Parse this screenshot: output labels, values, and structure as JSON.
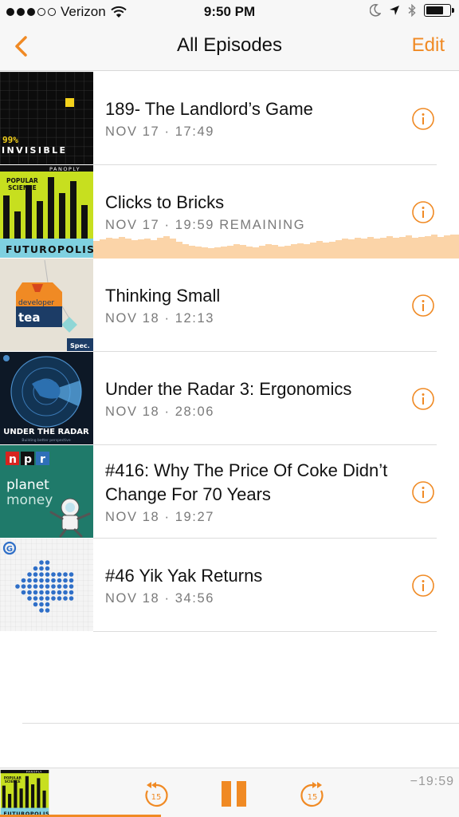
{
  "status_bar": {
    "carrier": "Verizon",
    "time": "9:50 PM",
    "signal_bars_filled": 3,
    "signal_bars_total": 5,
    "battery_level": 0.75,
    "icons": [
      "wifi-icon",
      "moon-icon",
      "location-arrow-icon",
      "bluetooth-icon",
      "battery-icon"
    ]
  },
  "nav": {
    "title": "All Episodes",
    "edit_label": "Edit",
    "back_icon": "chevron-left-icon"
  },
  "accent_color": "#f08a24",
  "episodes": [
    {
      "title": "189- The Landlord’s Game",
      "meta": "NOV 17 · 17:49",
      "podcast": "99% Invisible",
      "art_text": [
        "99%",
        "INVISIBLE"
      ],
      "now_playing": false
    },
    {
      "title": "Clicks to Bricks",
      "meta": "NOV 17 · 19:59 REMAINING",
      "podcast": "Futuropolis",
      "art_text": [
        "PANOPLY",
        "POPULAR",
        "SCIENCE",
        "FUTUROPOLIS"
      ],
      "now_playing": true
    },
    {
      "title": "Thinking Small",
      "meta": "NOV 18 · 12:13",
      "podcast": "Developer Tea",
      "art_text": [
        "developer",
        "tea",
        "Spec."
      ],
      "now_playing": false
    },
    {
      "title": "Under the Radar 3: Ergonomics",
      "meta": "NOV 18 · 28:06",
      "podcast": "Under the Radar",
      "art_text": [
        "UNDER THE RADAR",
        "Building better perspective"
      ],
      "now_playing": false
    },
    {
      "title": "#416: Why The Price Of Coke Didn’t Change For 70 Years",
      "meta": "NOV 18 · 19:27",
      "podcast": "Planet Money",
      "art_text": [
        "n",
        "p",
        "r",
        "planet",
        "money"
      ],
      "now_playing": false
    },
    {
      "title": "#46 Yik Yak Returns",
      "meta": "NOV 18 · 34:56",
      "podcast": "Gimlet",
      "art_text": [
        "G"
      ],
      "now_playing": false
    }
  ],
  "player": {
    "remaining": "−19:59",
    "skip_back_seconds": "15",
    "skip_forward_seconds": "15",
    "state": "playing",
    "progress": 0.35,
    "art_text": [
      "PANOPLY",
      "POPULAR",
      "SCIENCE",
      "FUTUROPOLIS"
    ]
  }
}
